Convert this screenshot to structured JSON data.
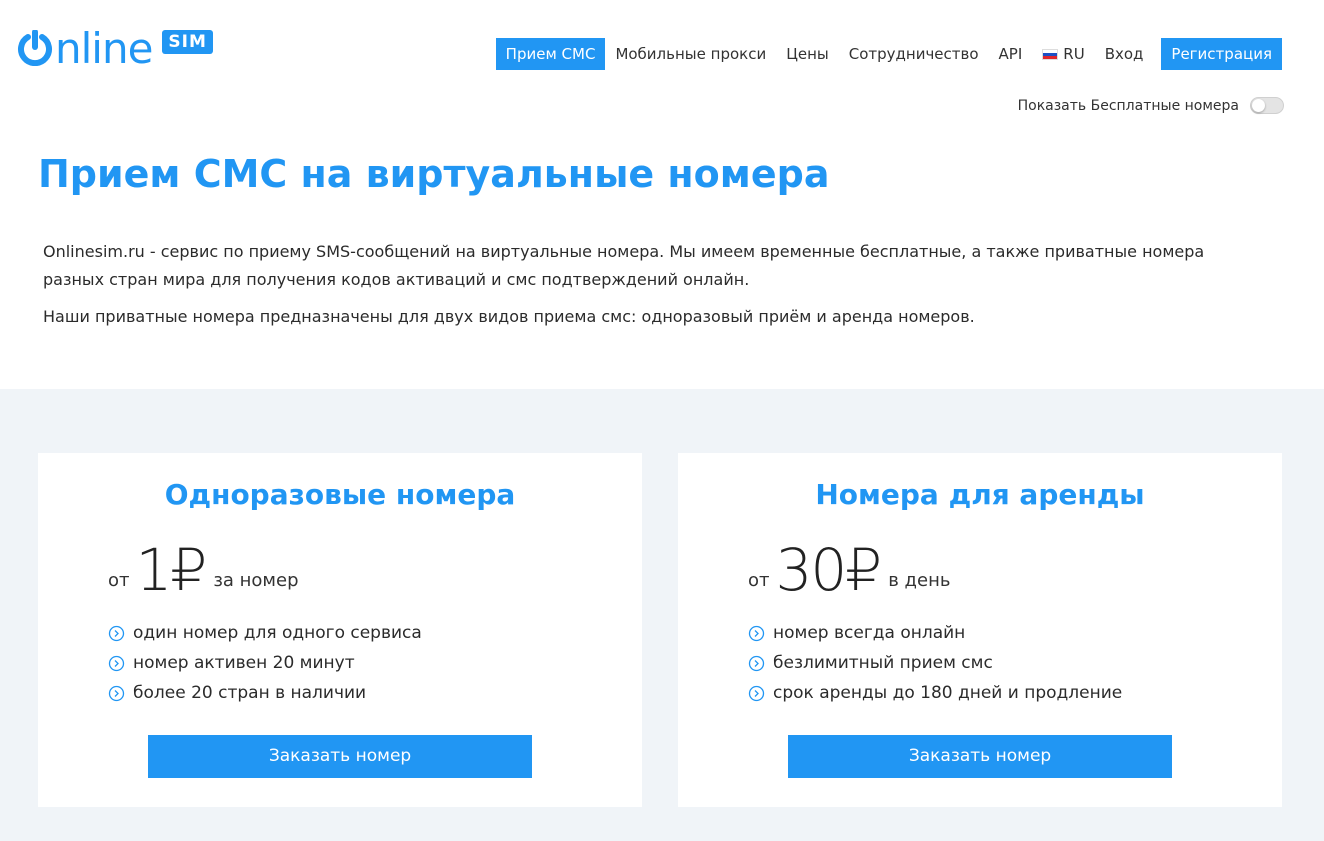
{
  "brand": {
    "word": "nline",
    "badge": "SIM",
    "color": "#2196f3"
  },
  "nav": {
    "items": [
      {
        "label": "Прием СМС",
        "active": true
      },
      {
        "label": "Мобильные прокси",
        "active": false
      },
      {
        "label": "Цены",
        "active": false
      },
      {
        "label": "Сотрудничество",
        "active": false
      },
      {
        "label": "API",
        "active": false
      },
      {
        "label": "RU",
        "active": false,
        "icon": "russia-flag-icon"
      },
      {
        "label": "Вход",
        "active": false
      },
      {
        "label": "Регистрация",
        "active": false
      }
    ]
  },
  "free_numbers": {
    "label": "Показать Бесплатные номера",
    "enabled": false
  },
  "hero": {
    "title": "Прием СМС на виртуальные номера",
    "paragraph1": "Onlinesim.ru - сервис по приему SMS-сообщений на виртуальные номера. Мы имеем временные бесплатные, а также приватные номера разных стран мира для получения кодов активаций и смс подтверждений онлайн.",
    "paragraph2": "Наши приватные номера предназначены для двух видов приема смс: одноразовый приём и аренда номеров."
  },
  "plans": [
    {
      "title": "Одноразовые номера",
      "price_from": "от",
      "price_value": "1₽",
      "price_unit": "за номер",
      "features": [
        "один номер для одного сервиса",
        "номер активен 20 минут",
        "более 20 стран в наличии"
      ],
      "button": "Заказать номер"
    },
    {
      "title": "Номера для аренды",
      "price_from": "от",
      "price_value": "30₽",
      "price_unit": "в день",
      "features": [
        "номер всегда онлайн",
        "безлимитный прием смс",
        "срок аренды до 180 дней и продление"
      ],
      "button": "Заказать номер"
    }
  ],
  "colors": {
    "accent": "#2196f3",
    "section_bg": "#f0f4f8"
  }
}
